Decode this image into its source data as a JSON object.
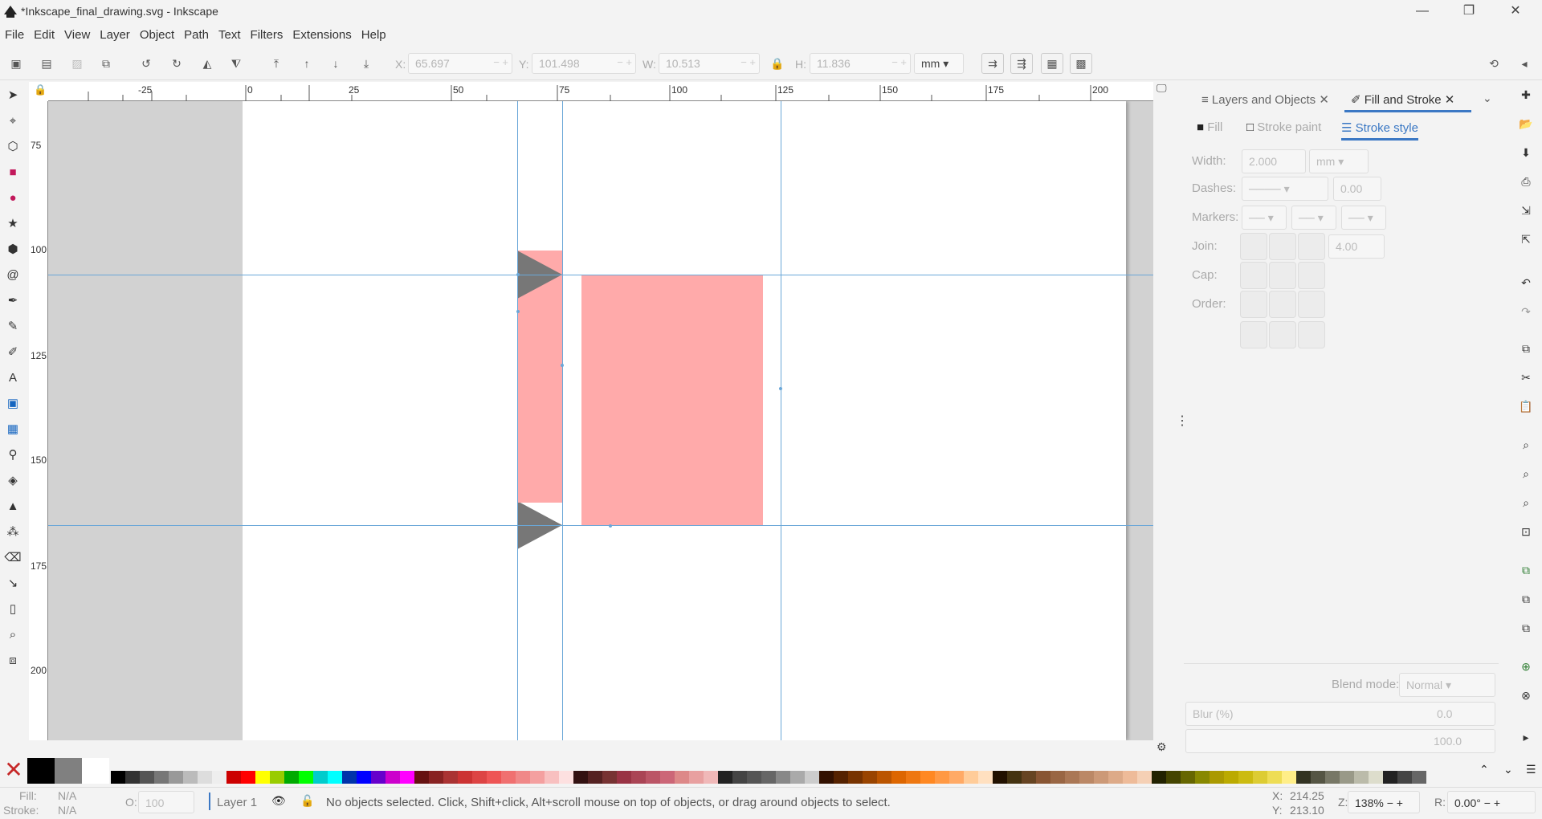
{
  "window": {
    "title": "*Inkscape_final_drawing.svg - Inkscape",
    "minimize": "—",
    "maximize": "❐",
    "close": "✕"
  },
  "menu": [
    "File",
    "Edit",
    "View",
    "Layer",
    "Object",
    "Path",
    "Text",
    "Filters",
    "Extensions",
    "Help"
  ],
  "toolbar": {
    "x_label": "X:",
    "x_value": "65.697",
    "y_label": "Y:",
    "y_value": "101.498",
    "w_label": "W:",
    "w_value": "10.513",
    "h_label": "H:",
    "h_value": "11.836",
    "unit": "mm"
  },
  "rulers": {
    "horizontal": [
      "-25",
      "0",
      "25",
      "50",
      "75",
      "100",
      "125",
      "150",
      "175",
      "200"
    ],
    "vertical": [
      "75",
      "100",
      "125",
      "150",
      "175",
      "200"
    ]
  },
  "dock": {
    "tabs": [
      {
        "label": "Layers and Objects"
      },
      {
        "label": "Fill and Stroke"
      }
    ],
    "subtabs": [
      "Fill",
      "Stroke paint",
      "Stroke style"
    ],
    "width_label": "Width:",
    "width_value": "2.000",
    "width_unit": "mm",
    "dashes_label": "Dashes:",
    "dashes_value": "0.00",
    "markers_label": "Markers:",
    "join_label": "Join:",
    "join_value": "4.00",
    "cap_label": "Cap:",
    "order_label": "Order:",
    "blend_label": "Blend mode:",
    "blend_value": "Normal",
    "blur_label": "Blur (%)",
    "blur_value": "0.0",
    "opacity_value": "100.0"
  },
  "palette": {
    "colors": [
      "#000000",
      "#333333",
      "#555555",
      "#777777",
      "#999999",
      "#bbbbbb",
      "#dddddd",
      "#eeeeee",
      "#cc0000",
      "#ff0000",
      "#ffff00",
      "#99cc00",
      "#00aa00",
      "#00ff00",
      "#00cccc",
      "#00ffff",
      "#0033aa",
      "#0000ff",
      "#6600cc",
      "#cc00cc",
      "#ff00ff",
      "#661111",
      "#882222",
      "#aa3333",
      "#cc3333",
      "#dd4444",
      "#ee5555",
      "#f07070",
      "#f08888",
      "#f4a0a0",
      "#f8c0c0",
      "#fde0e0",
      "#331111",
      "#552222",
      "#773333",
      "#993344",
      "#aa4455",
      "#bb5566",
      "#cc6677",
      "#dd8888",
      "#e8a0a0",
      "#f0b8b8",
      "#222222",
      "#444444",
      "#555555",
      "#666666",
      "#888888",
      "#aaaaaa",
      "#cccccc",
      "#331100",
      "#552200",
      "#773300",
      "#994400",
      "#bb5500",
      "#dd6600",
      "#ee7711",
      "#ff8822",
      "#ff9944",
      "#ffaa66",
      "#ffcc99",
      "#ffe0c0",
      "#221100",
      "#443311",
      "#664422",
      "#885533",
      "#996644",
      "#aa7755",
      "#bb8866",
      "#cc9977",
      "#ddaa88",
      "#eebb99",
      "#f5d0b5",
      "#222200",
      "#444400",
      "#666600",
      "#888800",
      "#aa9900",
      "#bbaa00",
      "#ccbb11",
      "#ddcc33",
      "#eedd55",
      "#ffee88",
      "#333322",
      "#555544",
      "#777766",
      "#999988",
      "#bbbbaa",
      "#ddddcc",
      "#222222",
      "#444444",
      "#666666"
    ]
  },
  "status": {
    "fill_label": "Fill:",
    "fill_value": "N/A",
    "stroke_label": "Stroke:",
    "stroke_value": "N/A",
    "opacity_label": "O:",
    "opacity_value": "100",
    "layer": "Layer 1",
    "message": "No objects selected. Click, Shift+click, Alt+scroll mouse on top of objects, or drag around objects to select.",
    "cursor_x_label": "X:",
    "cursor_x": "214.25",
    "cursor_y_label": "Y:",
    "cursor_y": "213.10",
    "zoom_label": "Z:",
    "zoom": "138%",
    "rotate_label": "R:",
    "rotate": "0.00°"
  },
  "colors": {
    "accent": "#3b78c4",
    "shape_fill": "#ffaaaa",
    "triangle_fill": "#777777",
    "guide": "#6aa7d8"
  }
}
